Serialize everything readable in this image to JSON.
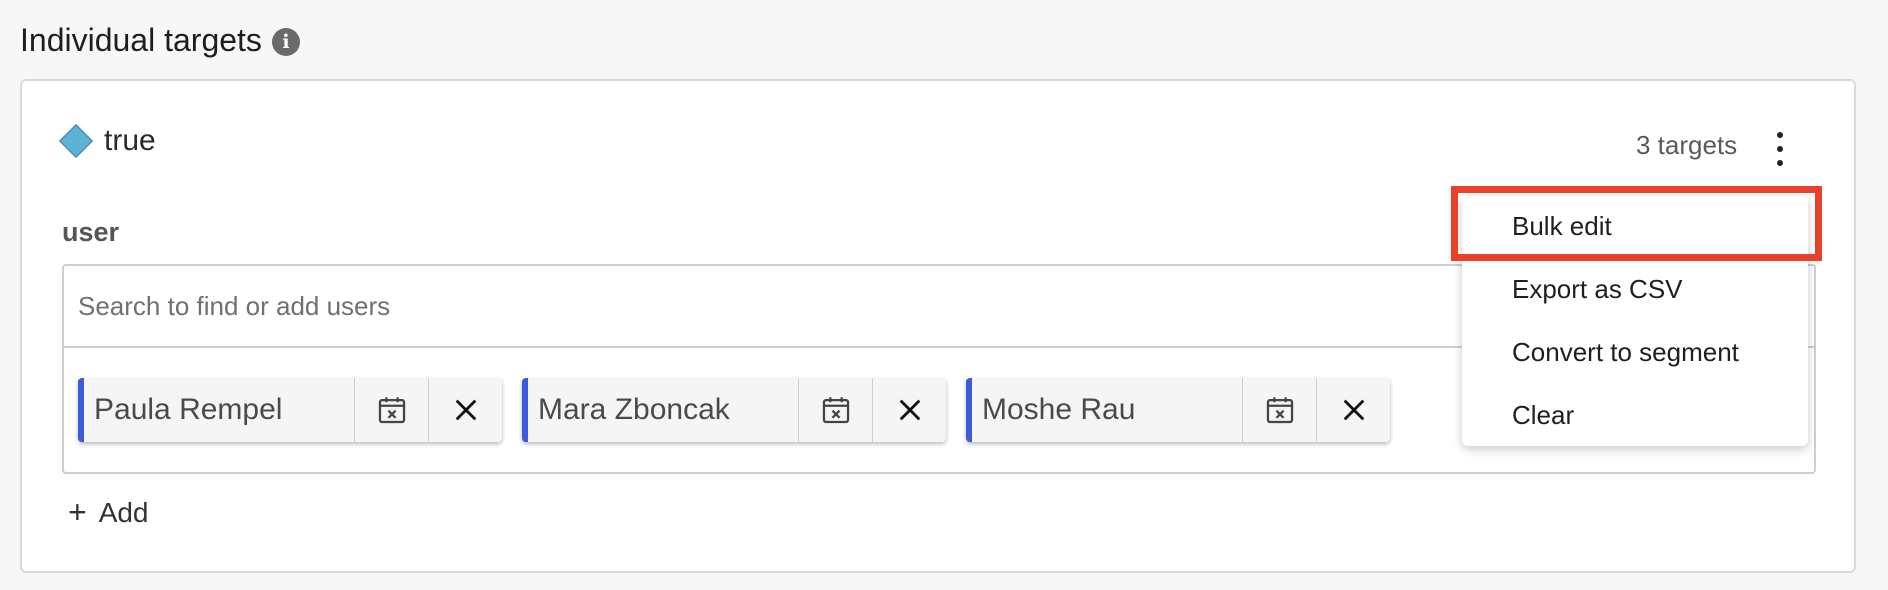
{
  "section": {
    "title": "Individual targets",
    "info_icon": "info-icon"
  },
  "variation": {
    "label": "true",
    "color": "#5bb3d3"
  },
  "targets_count": "3 targets",
  "user_section": {
    "label": "user",
    "search_placeholder": "Search to find or add users",
    "chips": [
      {
        "name": "Paula Rempel"
      },
      {
        "name": "Mara Zboncak"
      },
      {
        "name": "Moshe Rau"
      }
    ]
  },
  "add_label": "Add",
  "menu": {
    "items": [
      "Bulk edit",
      "Export as CSV",
      "Convert to segment",
      "Clear"
    ],
    "highlighted": "Bulk edit",
    "highlight_color": "#e8412b"
  },
  "chip_accent_color": "#3b5bdb"
}
